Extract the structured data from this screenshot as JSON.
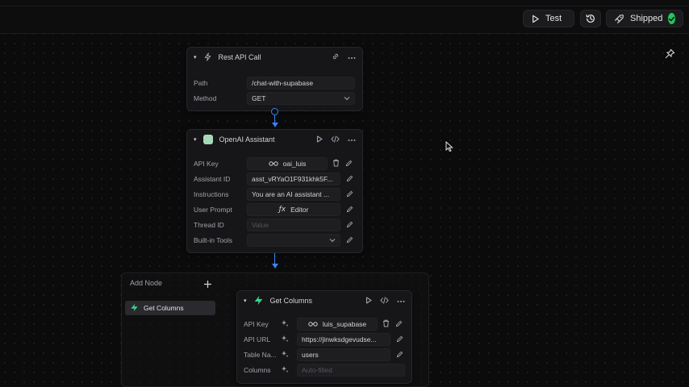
{
  "toolbar": {
    "test_label": "Test",
    "shipped_label": "Shipped"
  },
  "rest_node": {
    "title": "Rest API Call",
    "fields": [
      {
        "label": "Path",
        "value": "/chat-with-supabase"
      },
      {
        "label": "Method",
        "value": "GET"
      }
    ]
  },
  "openai_node": {
    "title": "OpenAI Assistant",
    "fields": [
      {
        "label": "API Key",
        "value": "oai_luis"
      },
      {
        "label": "Assistant ID",
        "value": "asst_vRYaO1F931khk5F..."
      },
      {
        "label": "Instructions",
        "value": "You are an AI assistant ..."
      },
      {
        "label": "User Prompt",
        "value": "Editor"
      },
      {
        "label": "Thread ID",
        "placeholder": "Value"
      },
      {
        "label": "Built-in Tools",
        "value": ""
      }
    ]
  },
  "add_panel": {
    "title": "Add Node",
    "item": "Get Columns"
  },
  "columns_node": {
    "title": "Get Columns",
    "fields": [
      {
        "label": "API Key",
        "value": "luis_supabase"
      },
      {
        "label": "API URL",
        "value": "https://jinwksdgevudse..."
      },
      {
        "label": "Table Na...",
        "value": "users"
      },
      {
        "label": "Columns",
        "placeholder": "Auto-filled"
      }
    ]
  },
  "colors": {
    "accent_blue": "#3b82f6",
    "success_green": "#22c55e",
    "supabase_green": "#3ecf8e"
  }
}
